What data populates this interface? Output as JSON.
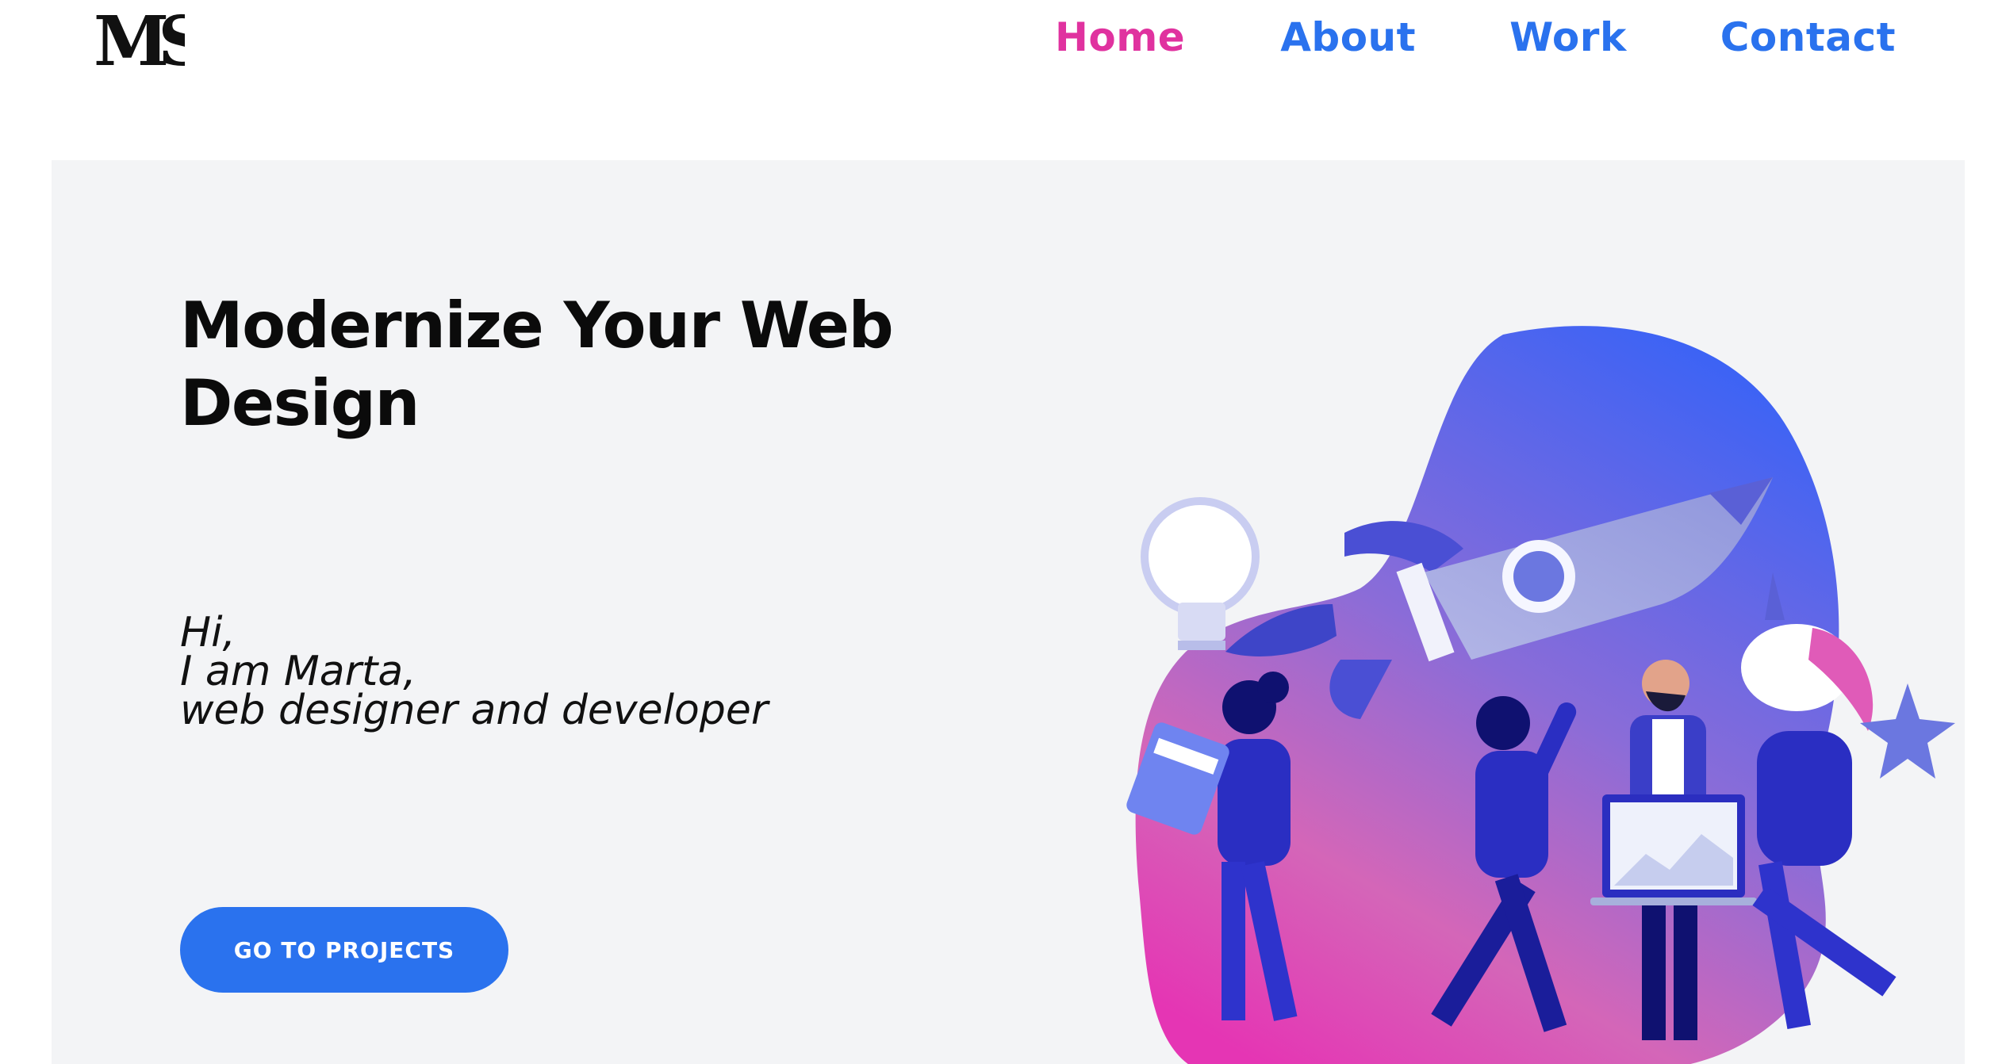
{
  "brand": {
    "logo_text": "MS"
  },
  "nav": {
    "items": [
      {
        "label": "Home",
        "active": true
      },
      {
        "label": "About",
        "active": false
      },
      {
        "label": "Work",
        "active": false
      },
      {
        "label": "Contact",
        "active": false
      }
    ]
  },
  "hero": {
    "title": "Modernize Your Web Design",
    "intro_lines": [
      "Hi,",
      "I am Marta,",
      "web designer and developer"
    ],
    "cta_label": "GO TO PROJECTS"
  },
  "colors": {
    "accent_blue": "#2a72ee",
    "accent_pink": "#e0329f",
    "hero_bg": "#f3f4f6"
  },
  "icons": {
    "illustration": "team-rocket-unicorn-illustration"
  }
}
